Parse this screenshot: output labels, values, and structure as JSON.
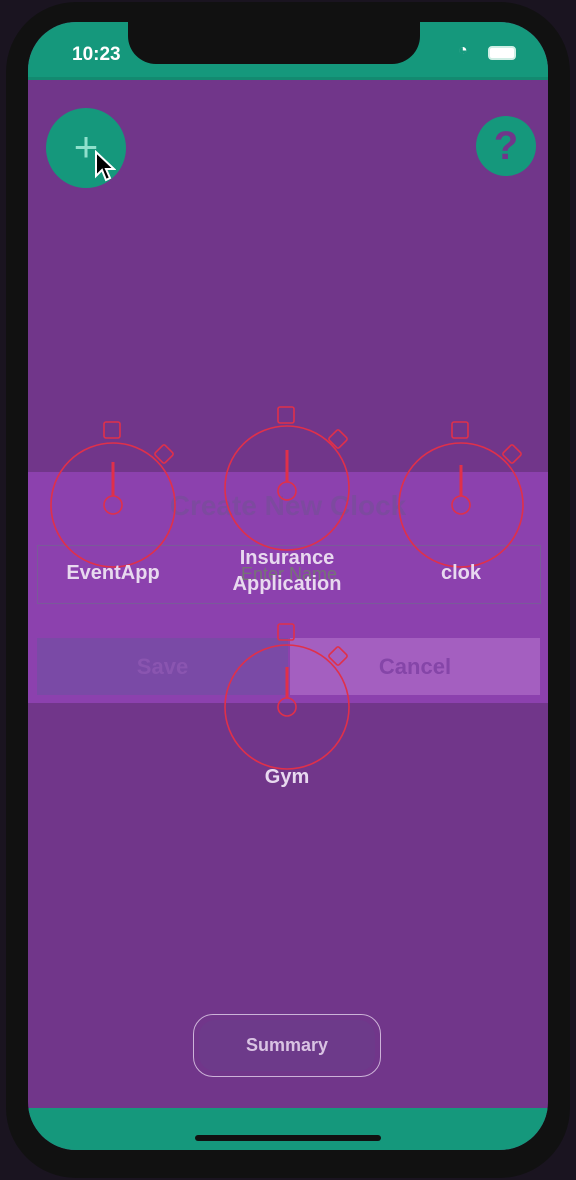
{
  "status_bar": {
    "time": "10:23"
  },
  "header": {
    "add_icon": "plus-icon",
    "help_label": "?"
  },
  "modal": {
    "title": "Create New Clock",
    "name_placeholder": "Enter Name",
    "save_label": "Save",
    "cancel_label": "Cancel"
  },
  "clocks": [
    {
      "label": "EventApp"
    },
    {
      "label": "Insurance Application"
    },
    {
      "label": "clok"
    },
    {
      "label": "Gym"
    }
  ],
  "footer": {
    "summary_label": "Summary"
  },
  "colors": {
    "primary": "#15987c",
    "background": "#71368a",
    "clock_stroke": "#e0304a"
  }
}
